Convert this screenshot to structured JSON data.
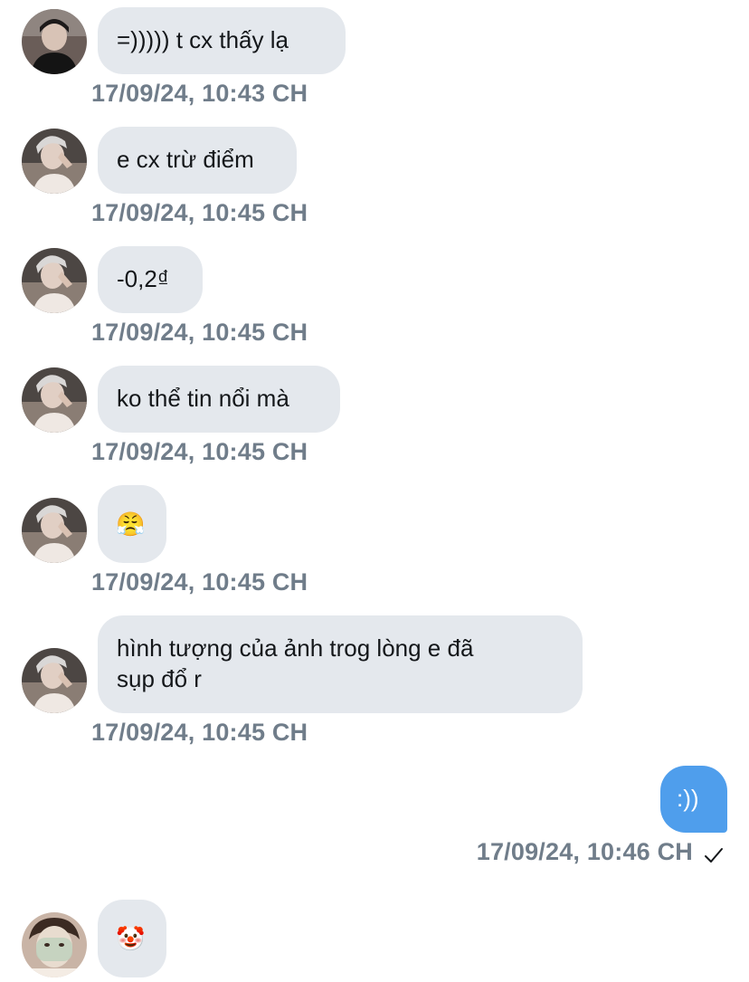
{
  "messages": [
    {
      "text": "=))))) t cx thấy lạ",
      "time": "17/09/24, 10:43 CH"
    },
    {
      "text": "e cx trừ điểm",
      "time": "17/09/24, 10:45 CH"
    },
    {
      "text": "-0,2₫",
      "time": "17/09/24, 10:45 CH"
    },
    {
      "text": "ko thể tin nổi mà",
      "time": "17/09/24, 10:45 CH"
    },
    {
      "text": "😤",
      "time": "17/09/24, 10:45 CH"
    },
    {
      "text": "hình tượng của ảnh trog lòng e đã\nsụp đổ r",
      "time": "17/09/24, 10:45 CH"
    },
    {
      "text": ":))",
      "time": "17/09/24, 10:46 CH",
      "outgoing": true
    },
    {
      "text": "🤡"
    }
  ],
  "colors": {
    "incoming_bubble": "#e4e8ed",
    "outgoing_bubble": "#4f9eec",
    "timestamp": "#707d8a"
  },
  "icons": {
    "read_receipt": "checkmark-icon"
  }
}
